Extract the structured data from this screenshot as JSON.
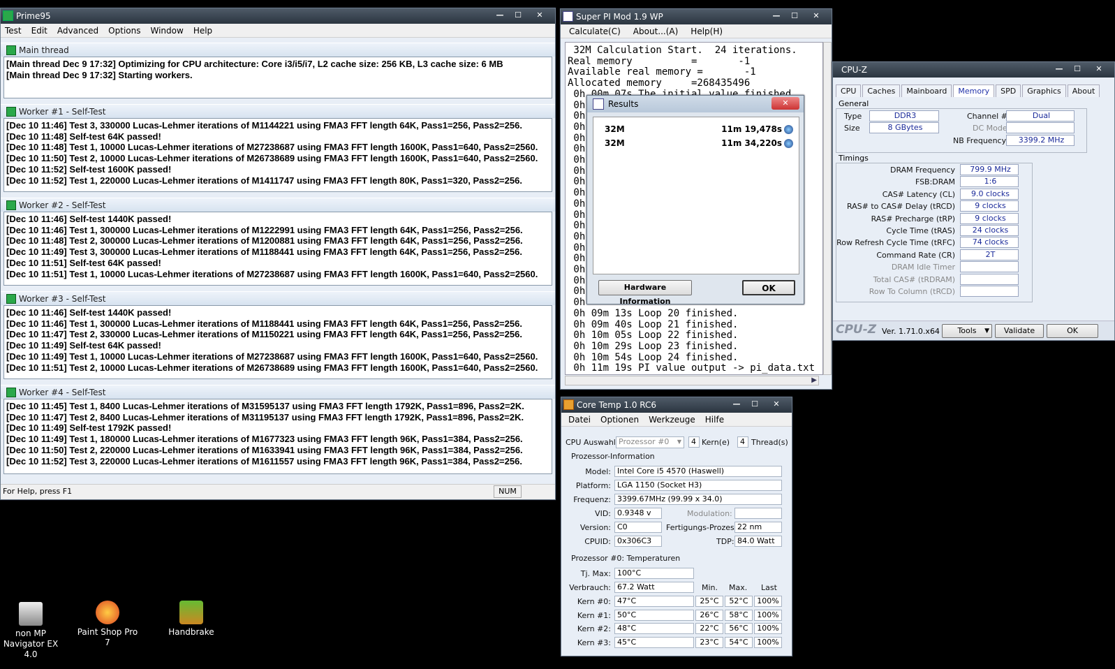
{
  "prime95": {
    "title": "Prime95",
    "menu": [
      "Test",
      "Edit",
      "Advanced",
      "Options",
      "Window",
      "Help"
    ],
    "panes": [
      {
        "title": "Main thread",
        "lines": [
          "[Main thread Dec 9 17:32] Optimizing for CPU architecture: Core i3/i5/i7, L2 cache size: 256 KB, L3 cache size: 6 MB",
          "[Main thread Dec 9 17:32] Starting workers."
        ]
      },
      {
        "title": "Worker #1 - Self-Test",
        "lines": [
          "[Dec 10 11:46] Test 3, 330000 Lucas-Lehmer iterations of M1144221 using FMA3 FFT length 64K, Pass1=256, Pass2=256.",
          "[Dec 10 11:48] Self-test 64K passed!",
          "[Dec 10 11:48] Test 1, 10000 Lucas-Lehmer iterations of M27238687 using FMA3 FFT length 1600K, Pass1=640, Pass2=2560.",
          "[Dec 10 11:50] Test 2, 10000 Lucas-Lehmer iterations of M26738689 using FMA3 FFT length 1600K, Pass1=640, Pass2=2560.",
          "[Dec 10 11:52] Self-test 1600K passed!",
          "[Dec 10 11:52] Test 1, 220000 Lucas-Lehmer iterations of M1411747 using FMA3 FFT length 80K, Pass1=320, Pass2=256."
        ]
      },
      {
        "title": "Worker #2 - Self-Test",
        "lines": [
          "[Dec 10 11:46] Self-test 1440K passed!",
          "[Dec 10 11:46] Test 1, 300000 Lucas-Lehmer iterations of M1222991 using FMA3 FFT length 64K, Pass1=256, Pass2=256.",
          "[Dec 10 11:48] Test 2, 300000 Lucas-Lehmer iterations of M1200881 using FMA3 FFT length 64K, Pass1=256, Pass2=256.",
          "[Dec 10 11:49] Test 3, 300000 Lucas-Lehmer iterations of M1188441 using FMA3 FFT length 64K, Pass1=256, Pass2=256.",
          "[Dec 10 11:51] Self-test 64K passed!",
          "[Dec 10 11:51] Test 1, 10000 Lucas-Lehmer iterations of M27238687 using FMA3 FFT length 1600K, Pass1=640, Pass2=2560."
        ]
      },
      {
        "title": "Worker #3 - Self-Test",
        "lines": [
          "[Dec 10 11:46] Self-test 1440K passed!",
          "[Dec 10 11:46] Test 1, 300000 Lucas-Lehmer iterations of M1188441 using FMA3 FFT length 64K, Pass1=256, Pass2=256.",
          "[Dec 10 11:47] Test 2, 330000 Lucas-Lehmer iterations of M1150221 using FMA3 FFT length 64K, Pass1=256, Pass2=256.",
          "[Dec 10 11:49] Self-test 64K passed!",
          "[Dec 10 11:49] Test 1, 10000 Lucas-Lehmer iterations of M27238687 using FMA3 FFT length 1600K, Pass1=640, Pass2=2560.",
          "[Dec 10 11:51] Test 2, 10000 Lucas-Lehmer iterations of M26738689 using FMA3 FFT length 1600K, Pass1=640, Pass2=2560."
        ]
      },
      {
        "title": "Worker #4 - Self-Test",
        "lines": [
          "[Dec 10 11:45] Test 1, 8400 Lucas-Lehmer iterations of M31595137 using FMA3 FFT length 1792K, Pass1=896, Pass2=2K.",
          "[Dec 10 11:47] Test 2, 8400 Lucas-Lehmer iterations of M31195137 using FMA3 FFT length 1792K, Pass1=896, Pass2=2K.",
          "[Dec 10 11:49] Self-test 1792K passed!",
          "[Dec 10 11:49] Test 1, 180000 Lucas-Lehmer iterations of M1677323 using FMA3 FFT length 96K, Pass1=384, Pass2=256.",
          "[Dec 10 11:50] Test 2, 220000 Lucas-Lehmer iterations of M1633941 using FMA3 FFT length 96K, Pass1=384, Pass2=256.",
          "[Dec 10 11:52] Test 3, 220000 Lucas-Lehmer iterations of M1611557 using FMA3 FFT length 96K, Pass1=384, Pass2=256."
        ]
      }
    ],
    "status": "For Help, press F1",
    "num": "NUM"
  },
  "superpi": {
    "title": "Super PI Mod 1.9 WP",
    "menu": [
      "Calculate(C)",
      "About...(A)",
      "Help(H)"
    ],
    "lines_top": [
      " 32M Calculation Start.  24 iterations.",
      "Real memory          =       -1",
      "Available real memory =       -1",
      "Allocated memory     =268435496",
      " 0h 00m 07s The initial value finished"
    ],
    "prefix": " 0h",
    "prefix_count": 19,
    "lines_bottom": [
      " 0h 09m 13s Loop 20 finished.",
      " 0h 09m 40s Loop 21 finished.",
      " 0h 10m 05s Loop 22 finished.",
      " 0h 10m 29s Loop 23 finished.",
      " 0h 10m 54s Loop 24 finished.",
      " 0h 11m 19s PI value output -> pi_data.txt"
    ]
  },
  "results": {
    "title": "Results",
    "rows": [
      {
        "label": "32M",
        "time": "11m 19,478s"
      },
      {
        "label": "32M",
        "time": "11m 34,220s"
      }
    ],
    "hw_button": "Hardware Information",
    "ok": "OK"
  },
  "cpuz": {
    "title": "CPU-Z",
    "tabs": [
      "CPU",
      "Caches",
      "Mainboard",
      "Memory",
      "SPD",
      "Graphics",
      "About"
    ],
    "active_tab": "Memory",
    "general_label": "General",
    "type_label": "Type",
    "type": "DDR3",
    "size_label": "Size",
    "size": "8 GBytes",
    "channel_label": "Channel #",
    "channel": "Dual",
    "dcmode_label": "DC Mode",
    "nbfreq_label": "NB Frequency",
    "nbfreq": "3399.2 MHz",
    "timings_label": "Timings",
    "timings": [
      {
        "label": "DRAM Frequency",
        "value": "799.9 MHz"
      },
      {
        "label": "FSB:DRAM",
        "value": "1:6"
      },
      {
        "label": "CAS# Latency (CL)",
        "value": "9.0 clocks"
      },
      {
        "label": "RAS# to CAS# Delay (tRCD)",
        "value": "9 clocks"
      },
      {
        "label": "RAS# Precharge (tRP)",
        "value": "9 clocks"
      },
      {
        "label": "Cycle Time (tRAS)",
        "value": "24 clocks"
      },
      {
        "label": "Row Refresh Cycle Time (tRFC)",
        "value": "74 clocks"
      },
      {
        "label": "Command Rate (CR)",
        "value": "2T"
      },
      {
        "label": "DRAM Idle Timer",
        "value": ""
      },
      {
        "label": "Total CAS# (tRDRAM)",
        "value": ""
      },
      {
        "label": "Row To Column (tRCD)",
        "value": ""
      }
    ],
    "brand": "CPU-Z",
    "version": "Ver. 1.71.0.x64",
    "tools": "Tools",
    "validate": "Validate",
    "ok": "OK"
  },
  "coretemp": {
    "title": "Core Temp 1.0 RC6",
    "menu": [
      "Datei",
      "Optionen",
      "Werkzeuge",
      "Hilfe"
    ],
    "cpu_select_label": "CPU Auswahl:",
    "cpu_select": "Prozessor #0",
    "cores": "4",
    "cores_label": "Kern(e)",
    "threads": "4",
    "threads_label": "Thread(s)",
    "info_label": "Prozessor-Information",
    "model_label": "Model:",
    "model": "Intel Core i5 4570 (Haswell)",
    "platform_label": "Platform:",
    "platform": "LGA 1150 (Socket H3)",
    "freq_label": "Frequenz:",
    "freq": "3399.67MHz (99.99 x 34.0)",
    "vid_label": "VID:",
    "vid": "0.9348 v",
    "modulation_label": "Modulation:",
    "version_label": "Version:",
    "version": "C0",
    "process_label": "Fertigungs-Prozess:",
    "process": "22 nm",
    "cpuid_label": "CPUID:",
    "cpuid": "0x306C3",
    "tdp_label": "TDP:",
    "tdp": "84.0 Watt",
    "temps_label": "Prozessor #0: Temperaturen",
    "tjmax_label": "Tj. Max:",
    "tjmax": "100°C",
    "power_label": "Verbrauch:",
    "power": "67.2 Watt",
    "min_h": "Min.",
    "max_h": "Max.",
    "last_h": "Last",
    "cores_list": [
      {
        "label": "Kern #0:",
        "temp": "47°C",
        "min": "25°C",
        "max": "52°C",
        "load": "100%"
      },
      {
        "label": "Kern #1:",
        "temp": "50°C",
        "min": "26°C",
        "max": "58°C",
        "load": "100%"
      },
      {
        "label": "Kern #2:",
        "temp": "48°C",
        "min": "22°C",
        "max": "56°C",
        "load": "100%"
      },
      {
        "label": "Kern #3:",
        "temp": "45°C",
        "min": "23°C",
        "max": "54°C",
        "load": "100%"
      }
    ]
  },
  "desktop": [
    {
      "label": "non MP Navigator EX 4.0",
      "icon": "scanner-icon"
    },
    {
      "label": "Paint Shop Pro 7",
      "icon": "palette-icon"
    },
    {
      "label": "Handbrake",
      "icon": "handbrake-icon"
    }
  ]
}
